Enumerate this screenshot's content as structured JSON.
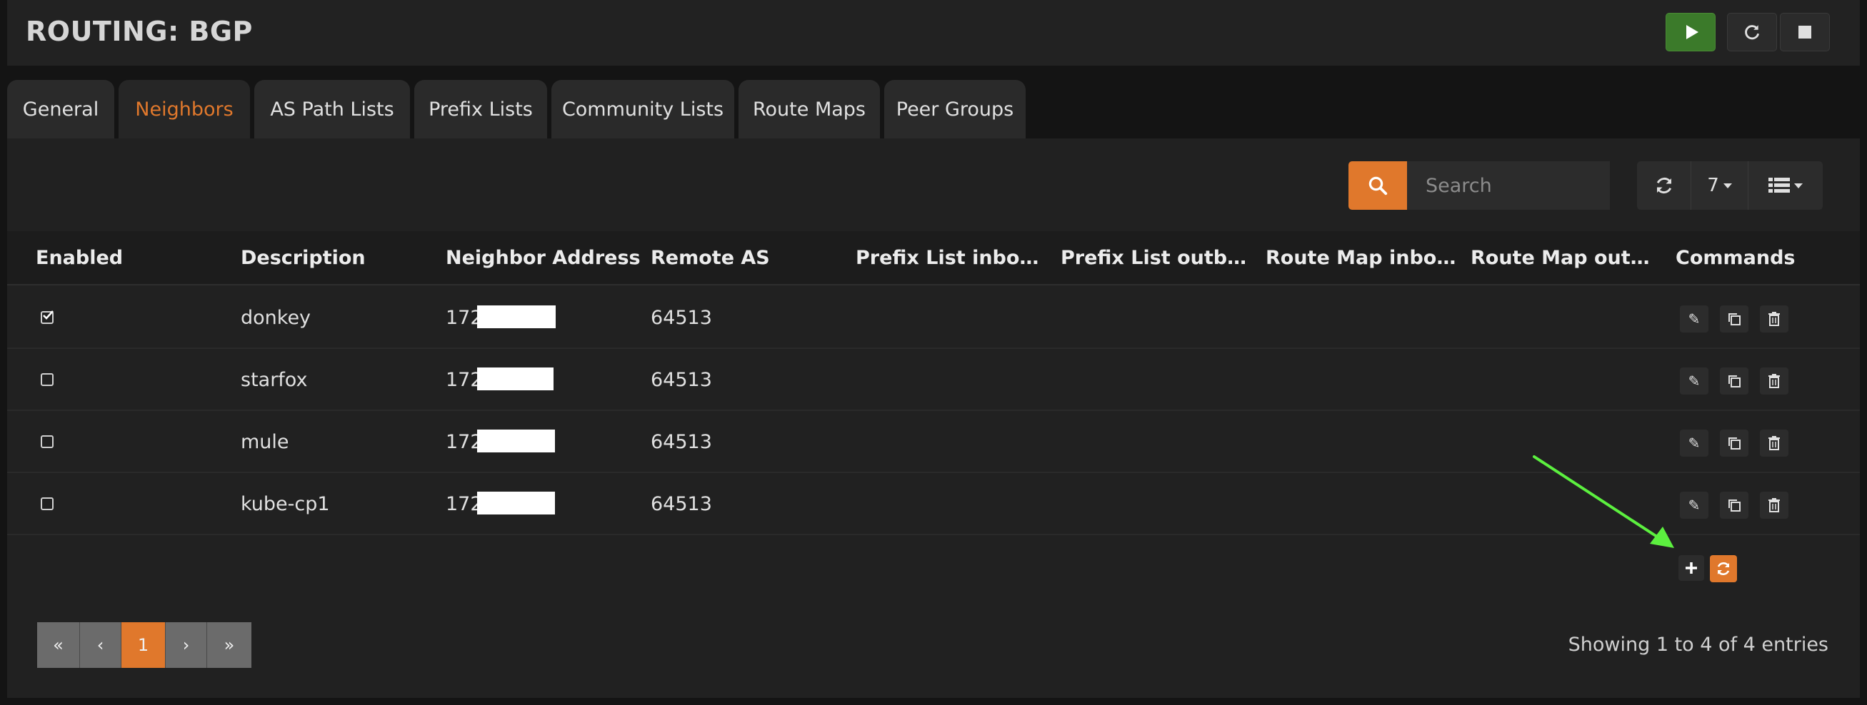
{
  "header": {
    "title": "ROUTING: BGP"
  },
  "service": {
    "start": "play-icon",
    "restart": "refresh-icon",
    "stop": "stop-icon",
    "start_color": "#3b7a2a"
  },
  "tabs": [
    {
      "label": "General"
    },
    {
      "label": "Neighbors",
      "active": true
    },
    {
      "label": "AS Path Lists"
    },
    {
      "label": "Prefix Lists"
    },
    {
      "label": "Community Lists"
    },
    {
      "label": "Route Maps"
    },
    {
      "label": "Peer Groups"
    }
  ],
  "toolbar": {
    "search_placeholder": "Search",
    "page_size": "7",
    "accent": "#e0782c"
  },
  "table": {
    "columns": [
      "Enabled",
      "Description",
      "Neighbor Address",
      "Remote AS",
      "Prefix List inbo…",
      "Prefix List outb…",
      "Route Map inbo…",
      "Route Map out…",
      "Commands"
    ],
    "rows": [
      {
        "enabled": true,
        "description": "donkey",
        "address": "172.",
        "remote_as": "64513"
      },
      {
        "enabled": false,
        "description": "starfox",
        "address": "172.",
        "remote_as": "64513"
      },
      {
        "enabled": false,
        "description": "mule",
        "address": "172.",
        "remote_as": "64513"
      },
      {
        "enabled": false,
        "description": "kube-cp1",
        "address": "172.",
        "remote_as": "64513"
      }
    ]
  },
  "pagination": {
    "first": "«",
    "prev": "‹",
    "current": "1",
    "next": "›",
    "last": "»"
  },
  "info": "Showing 1 to 4 of 4 entries",
  "annotation": {
    "arrow_color": "#5cf03f"
  }
}
